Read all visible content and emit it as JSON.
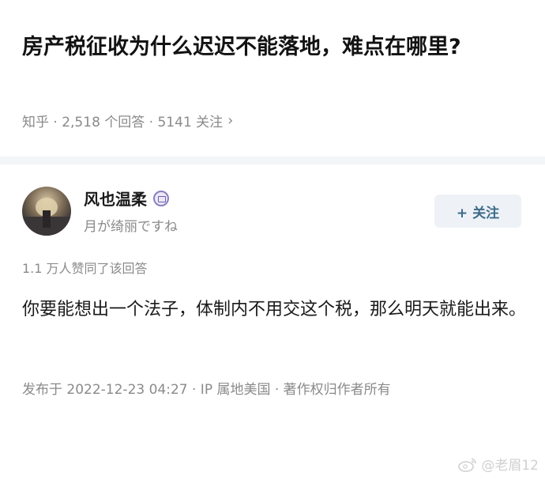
{
  "question": {
    "title": "房产税征收为什么迟迟不能落地，难点在哪里?",
    "meta": "知乎 · 2,518 个回答 · 5141 关注",
    "chevron": "›"
  },
  "answer": {
    "author_name": "风也温柔",
    "author_bio": "月が绮丽ですね",
    "follow_label": "+ 关注",
    "approve_text": "1.1 万人赞同了该回答",
    "body": "你要能想出一个法子，体制内不用交这个税，那么明天就能出来。",
    "meta": "发布于 2022-12-23 04:27 · IP 属地美国 · 著作权归作者所有"
  },
  "watermark": {
    "text": "@老眉12",
    "icon": "weibo-icon"
  }
}
